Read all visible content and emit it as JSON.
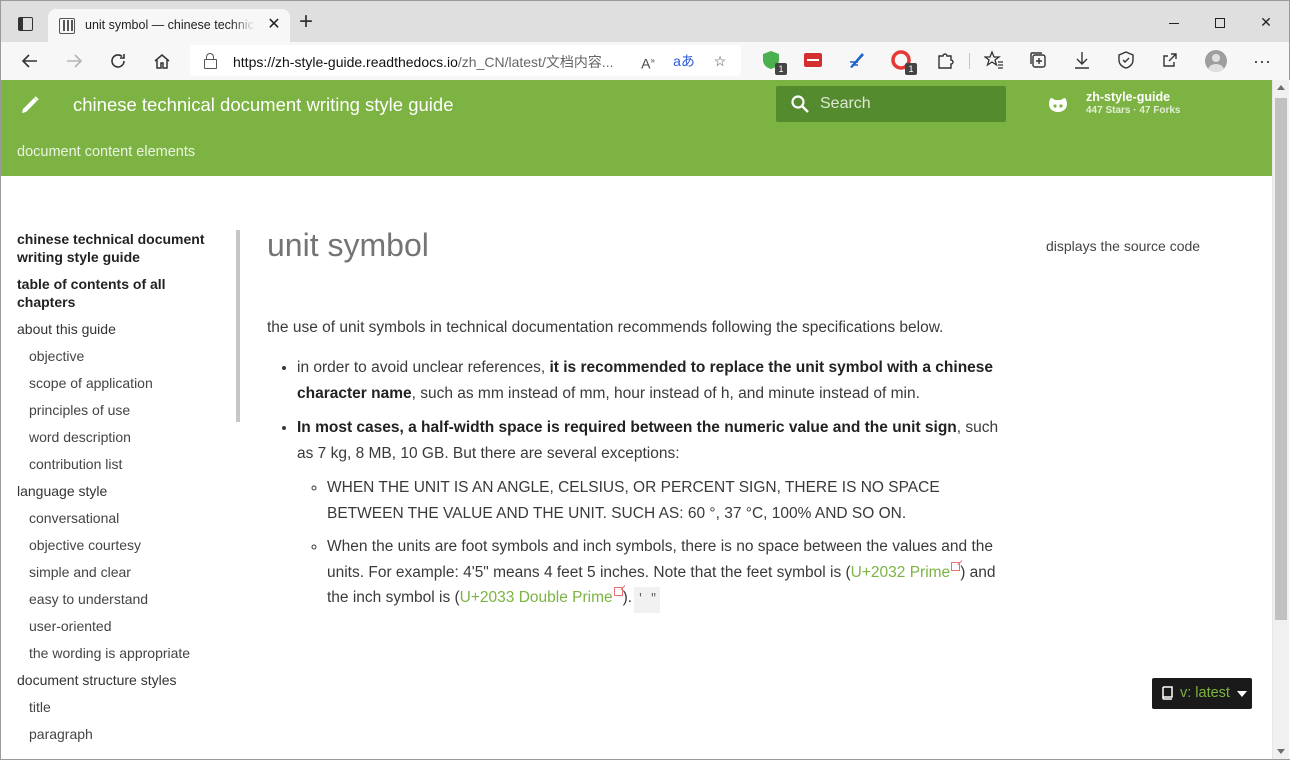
{
  "browser": {
    "tab_title": "unit symbol — chinese technical document writing style guide",
    "url_host": "https://zh-style-guide.readthedocs.io",
    "url_path": "/zh_CN/latest/文档内容...",
    "ext_badge_1": "1",
    "ext_badge_2": "1"
  },
  "header": {
    "site_title": "chinese technical document writing style guide",
    "section": "document content elements",
    "search_placeholder": "Search",
    "repo_name": "zh-style-guide",
    "repo_stats": "447 Stars · 47 Forks"
  },
  "nav": {
    "items": [
      {
        "label": "chinese technical document writing style guide"
      },
      {
        "label": "table of contents of all chapters"
      },
      {
        "label": "about this guide"
      },
      {
        "label": "objective"
      },
      {
        "label": "scope of application"
      },
      {
        "label": "principles of use"
      },
      {
        "label": "word description"
      },
      {
        "label": "contribution list"
      },
      {
        "label": "language style"
      },
      {
        "label": "conversational"
      },
      {
        "label": "objective courtesy"
      },
      {
        "label": "simple and clear"
      },
      {
        "label": "easy to understand"
      },
      {
        "label": "user-oriented"
      },
      {
        "label": "the wording is appropriate"
      },
      {
        "label": "document structure styles"
      },
      {
        "label": "title"
      },
      {
        "label": "paragraph"
      }
    ]
  },
  "content": {
    "title": "unit symbol",
    "intro": "the use of unit symbols in technical documentation recommends following the specifications below.",
    "b1_pre": "in order to avoid unclear references, ",
    "b1_bold": "it is recommended to replace the unit symbol with a chinese character name",
    "b1_post": ", such as mm instead of mm, hour instead of h, and minute instead of min.",
    "b2_bold": "In most cases, a half-width space is required between the numeric value and the unit sign",
    "b2_post": ", such as 7 kg, 8 MB, 10 GB. But there are several exceptions:",
    "s1": "WHEN THE UNIT IS AN ANGLE, CELSIUS, OR PERCENT SIGN, THERE IS NO SPACE BETWEEN THE VALUE AND THE UNIT. SUCH AS: 60 °, 37 °C, 100% AND SO ON.",
    "s2_pre": "When the units are foot symbols and inch symbols, there is no space between the values and the units. For example: 4'5\" means 4 feet 5 inches. Note that the feet symbol is (",
    "s2_link1": "U+2032 Prime",
    "s2_mid": ") and the inch symbol is (",
    "s2_link2": "U+2033 Double Prime",
    "s2_end": ").",
    "s2_code": "′ ″"
  },
  "toc_right": "displays the source code",
  "version": "v: latest",
  "colors": {
    "brand_green": "#7cb342",
    "search_green": "#558b2f",
    "version_bg": "#1a1a1a"
  },
  "icons": [
    "pencil-icon",
    "search-icon",
    "github-icon",
    "book-icon",
    "caret-down-icon"
  ]
}
